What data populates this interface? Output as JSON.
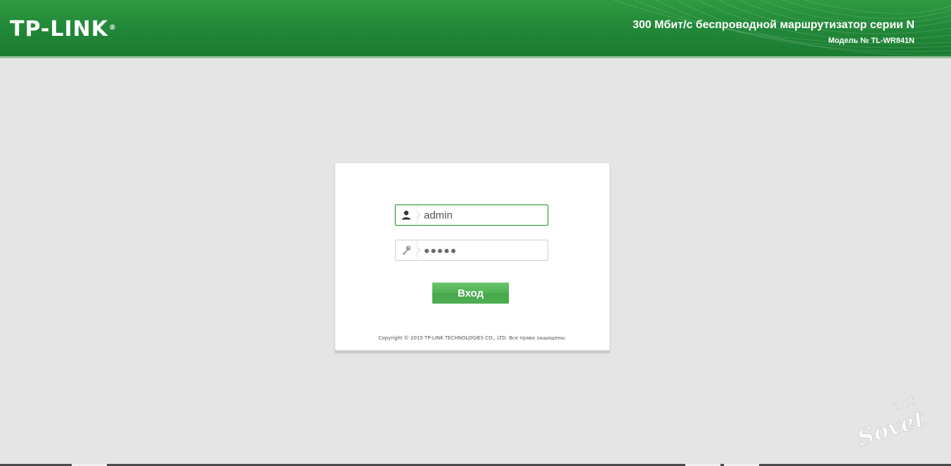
{
  "header": {
    "logo_text": "TP-LINK",
    "logo_registered": "®",
    "product_title": "300 Мбит/с беспроводной маршрутизатор серии N",
    "model_number": "Модель № TL-WR841N"
  },
  "login": {
    "username_value": "admin",
    "password_value": "●●●●●",
    "submit_label": "Вход",
    "copyright": "Copyright © 2015 TP-LINK TECHNOLOGIES CO., LTD. Все права защищены."
  },
  "icons": {
    "username": "user-icon",
    "password": "key-icon",
    "watermark": "clubsovet-watermark-logo"
  },
  "watermark": {
    "text_top": "club",
    "text_main": "Sovet"
  },
  "colors": {
    "header_green": "#23893a",
    "focus_border": "#2e9a3f",
    "button_green": "#4fb255",
    "background": "#e5e5e5"
  }
}
